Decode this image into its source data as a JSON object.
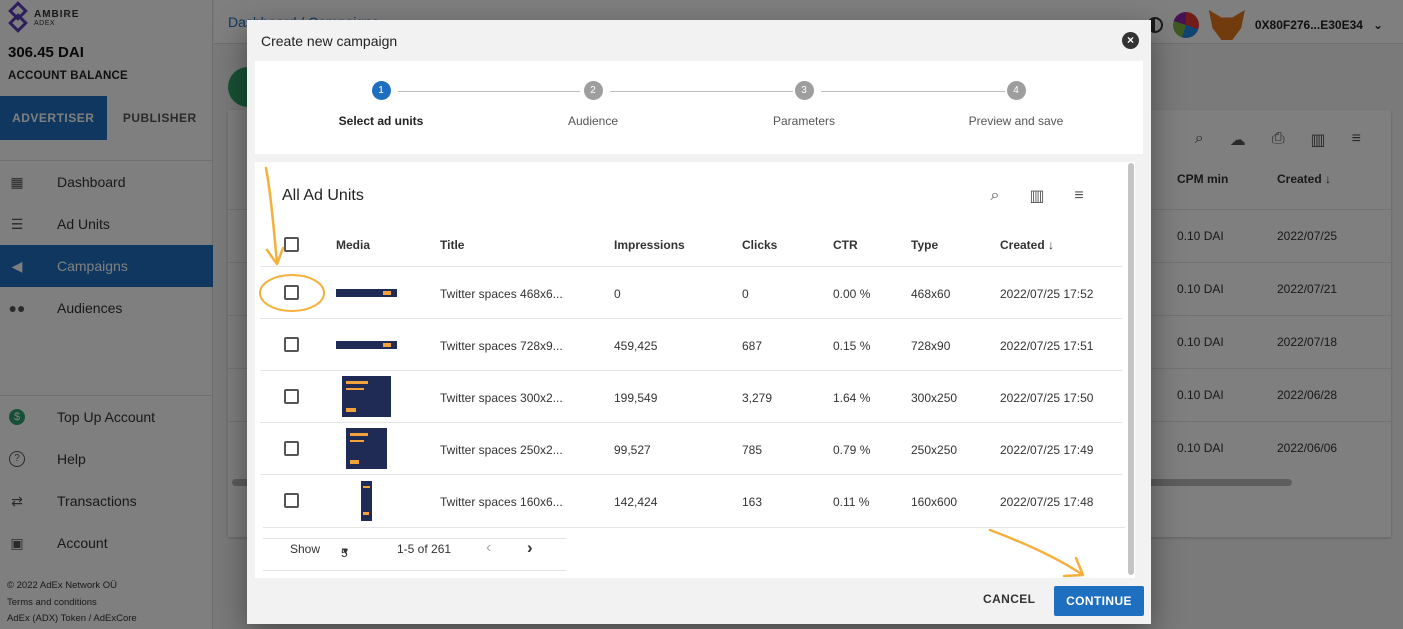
{
  "brand": {
    "name": "AMBIRE",
    "sub": "ADEX"
  },
  "account": {
    "balance": "306.45 DAI",
    "balance_label": "ACCOUNT BALANCE"
  },
  "roles": [
    "ADVERTISER",
    "PUBLISHER"
  ],
  "nav": [
    {
      "label": "Dashboard",
      "icon": "dashboard-icon"
    },
    {
      "label": "Ad Units",
      "icon": "list-icon"
    },
    {
      "label": "Campaigns",
      "icon": "megaphone-icon",
      "active": true
    },
    {
      "label": "Audiences",
      "icon": "people-icon"
    }
  ],
  "nav_bottom": [
    {
      "label": "Top Up Account",
      "icon": "dollar-icon"
    },
    {
      "label": "Help",
      "icon": "help-icon"
    },
    {
      "label": "Transactions",
      "icon": "swap-icon"
    },
    {
      "label": "Account",
      "icon": "account-box-icon"
    }
  ],
  "footer": {
    "copyright": "© 2022  AdEx Network OÜ",
    "terms": "Terms and conditions",
    "token": "AdEx (ADX) Token / AdExCore"
  },
  "header": {
    "breadcrumb": "Dashboard / Campaigns",
    "wallet": "0X80F276...E30E34"
  },
  "background_table": {
    "headers": {
      "cpm": "CPM min",
      "created": "Created ↓"
    },
    "rows": [
      {
        "cpm": "0.10 DAI",
        "created": "2022/07/25"
      },
      {
        "cpm": "0.10 DAI",
        "created": "2022/07/21"
      },
      {
        "cpm": "0.10 DAI",
        "created": "2022/07/18"
      },
      {
        "cpm": "0.10 DAI",
        "created": "2022/06/28"
      },
      {
        "cpm": "0.10 DAI",
        "created": "2022/06/06"
      }
    ]
  },
  "modal": {
    "title": "Create new campaign",
    "steps": [
      {
        "num": "1",
        "label": "Select ad units",
        "active": true
      },
      {
        "num": "2",
        "label": "Audience"
      },
      {
        "num": "3",
        "label": "Parameters"
      },
      {
        "num": "4",
        "label": "Preview and save"
      }
    ],
    "units_title": "All Ad Units",
    "columns": {
      "media": "Media",
      "title": "Title",
      "impressions": "Impressions",
      "clicks": "Clicks",
      "ctr": "CTR",
      "type": "Type",
      "created": "Created ↓"
    },
    "rows": [
      {
        "title": "Twitter spaces 468x6...",
        "impressions": "0",
        "clicks": "0",
        "ctr": "0.00 %",
        "type": "468x60",
        "created": "2022/07/25 17:52"
      },
      {
        "title": "Twitter spaces 728x9...",
        "impressions": "459,425",
        "clicks": "687",
        "ctr": "0.15 %",
        "type": "728x90",
        "created": "2022/07/25 17:51"
      },
      {
        "title": "Twitter spaces 300x2...",
        "impressions": "199,549",
        "clicks": "3,279",
        "ctr": "1.64 %",
        "type": "300x250",
        "created": "2022/07/25 17:50"
      },
      {
        "title": "Twitter spaces 250x2...",
        "impressions": "99,527",
        "clicks": "785",
        "ctr": "0.79 %",
        "type": "250x250",
        "created": "2022/07/25 17:49"
      },
      {
        "title": "Twitter spaces 160x6...",
        "impressions": "142,424",
        "clicks": "163",
        "ctr": "0.11 %",
        "type": "160x600",
        "created": "2022/07/25 17:48"
      }
    ],
    "pager": {
      "show_label": "Show",
      "per_page": "5",
      "range": "1-5 of 261"
    },
    "cancel": "CANCEL",
    "continue": "CONTINUE"
  },
  "colors": {
    "primary": "#1e6fc0",
    "annotation": "#f5b03c",
    "accent_green": "#2ea36a"
  }
}
